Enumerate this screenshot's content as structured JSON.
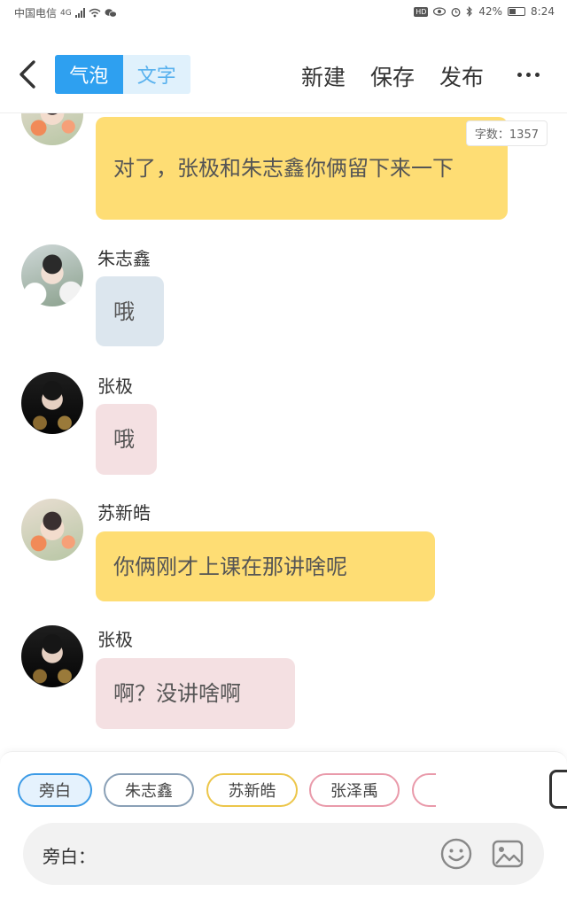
{
  "status_bar": {
    "carrier": "中国电信",
    "network": "4G",
    "battery": "42%",
    "time": "8:24"
  },
  "header": {
    "tabs": [
      {
        "label": "气泡",
        "active": true
      },
      {
        "label": "文字",
        "active": false
      }
    ],
    "actions": {
      "new_label": "新建",
      "save_label": "保存",
      "publish_label": "发布"
    }
  },
  "word_count": "字数：1357",
  "messages": [
    {
      "speaker": "",
      "text": "对了，张极和朱志鑫你俩留下来一下",
      "bubble_color": "#fedd74"
    },
    {
      "speaker": "朱志鑫",
      "text": "哦",
      "bubble_color": "#dce6ee"
    },
    {
      "speaker": "张极",
      "text": "哦",
      "bubble_color": "#f4e0e2"
    },
    {
      "speaker": "苏新皓",
      "text": "你俩刚才上课在那讲啥呢",
      "bubble_color": "#fedd74"
    },
    {
      "speaker": "张极",
      "text": "啊？没讲啥啊",
      "bubble_color": "#f4e0e2"
    }
  ],
  "characters": [
    {
      "label": "旁白",
      "border": "#3d9be6",
      "active": true
    },
    {
      "label": "朱志鑫",
      "border": "#8aa0b6",
      "active": false
    },
    {
      "label": "苏新皓",
      "border": "#ecc64a",
      "active": false
    },
    {
      "label": "张泽禹",
      "border": "#e99aaa",
      "active": false
    }
  ],
  "input": {
    "label": "旁白："
  },
  "icons": {
    "back": "chevron-left-icon",
    "more": "more-dots-icon",
    "emoji": "emoji-icon",
    "image": "image-icon"
  }
}
